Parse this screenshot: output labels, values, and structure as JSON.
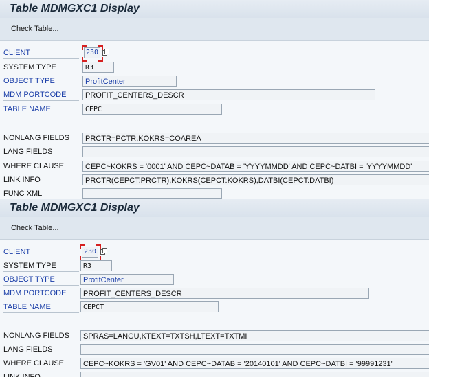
{
  "panels": [
    {
      "title": "Table MDMGXC1 Display",
      "toolbar": {
        "check_table": "Check Table..."
      },
      "labels": {
        "client": "CLIENT",
        "system_type": "SYSTEM TYPE",
        "object_type": "OBJECT TYPE",
        "mdm_portcode": "MDM PORTCODE",
        "table_name": "TABLE NAME",
        "nonlang_fields": "NONLANG FIELDS",
        "lang_fields": "LANG FIELDS",
        "where_clause": "WHERE CLAUSE",
        "link_info": "LINK INFO",
        "func_xml": "FUNC XML"
      },
      "values": {
        "client": "230",
        "system_type": "R3",
        "object_type": "ProfitCenter",
        "mdm_portcode": "PROFIT_CENTERS_DESCR",
        "table_name": "CEPC",
        "nonlang_fields": "PRCTR=PCTR,KOKRS=COAREA",
        "lang_fields": "",
        "where_clause": "CEPC~KOKRS = '0001' AND CEPC~DATAB = 'YYYYMMDD' AND CEPC~DATBI = 'YYYYMMDD'",
        "link_info": "PRCTR(CEPCT:PRCTR),KOKRS(CEPCT:KOKRS),DATBI(CEPCT:DATBI)",
        "func_xml": ""
      }
    },
    {
      "title": "Table MDMGXC1 Display",
      "toolbar": {
        "check_table": "Check Table..."
      },
      "labels": {
        "client": "CLIENT",
        "system_type": "SYSTEM TYPE",
        "object_type": "OBJECT TYPE",
        "mdm_portcode": "MDM PORTCODE",
        "table_name": "TABLE NAME",
        "nonlang_fields": "NONLANG FIELDS",
        "lang_fields": "LANG FIELDS",
        "where_clause": "WHERE CLAUSE",
        "link_info": "LINK INFO"
      },
      "values": {
        "client": "230",
        "system_type": "R3",
        "object_type": "ProfitCenter",
        "mdm_portcode": "PROFIT_CENTERS_DESCR",
        "table_name": "CEPCT",
        "nonlang_fields": "SPRAS=LANGU,KTEXT=TXTSH,LTEXT=TXTMI",
        "lang_fields": "",
        "where_clause": "CEPC~KOKRS = 'GV01' AND CEPC~DATAB = '20140101' AND CEPC~DATBI = '99991231'",
        "link_info": ""
      }
    }
  ],
  "colors": {
    "label_blue": "#1a3ea8",
    "focus_red": "#d52020",
    "panel_bg": "#f4f7fa"
  },
  "icons": [
    "copy-icon"
  ]
}
